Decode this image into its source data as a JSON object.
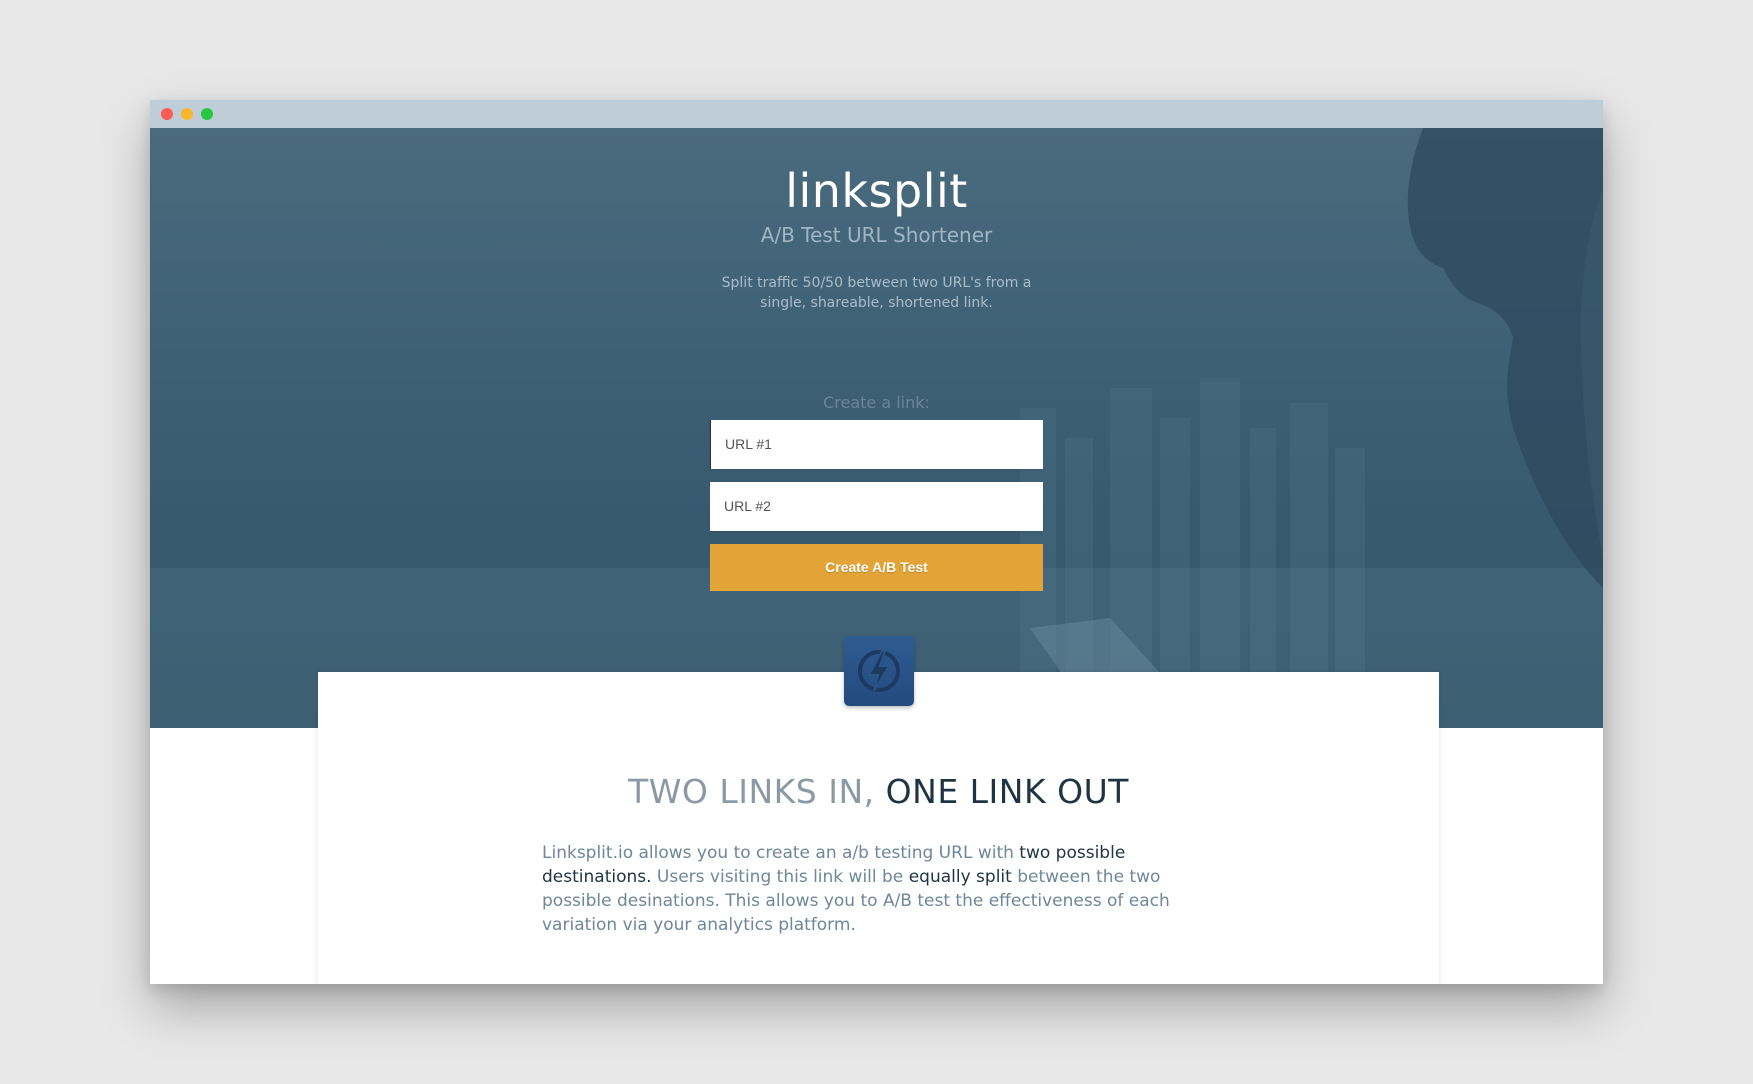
{
  "window": {
    "controls": [
      "close",
      "minimize",
      "maximize"
    ]
  },
  "hero": {
    "brand": "linksplit",
    "tagline": "A/B Test URL Shortener",
    "description": "Split traffic 50/50 between two URL's from a single, shareable, shortened link.",
    "create_label": "Create a link:",
    "url1_placeholder": "URL #1",
    "url2_placeholder": "URL #2",
    "button_label": "Create A/B Test"
  },
  "feature": {
    "icon": "lightning-bolt-icon",
    "headline_light": "TWO LINKS IN,",
    "headline_dark": "ONE LINK OUT",
    "text": {
      "p1": "Linksplit.io allows you to create an a/b testing URL with ",
      "b1": "two possible destinations.",
      "p2": " Users visiting this link will be ",
      "b2": "equally split",
      "p3": " between the two possible desinations. This allows you to A/B test the effectiveness of each variation via your analytics platform."
    }
  },
  "colors": {
    "accent": "#e3a437",
    "hero_bg": "#3f6176",
    "logo_tile": "#2a5488",
    "heading_dark": "#1f3442"
  }
}
